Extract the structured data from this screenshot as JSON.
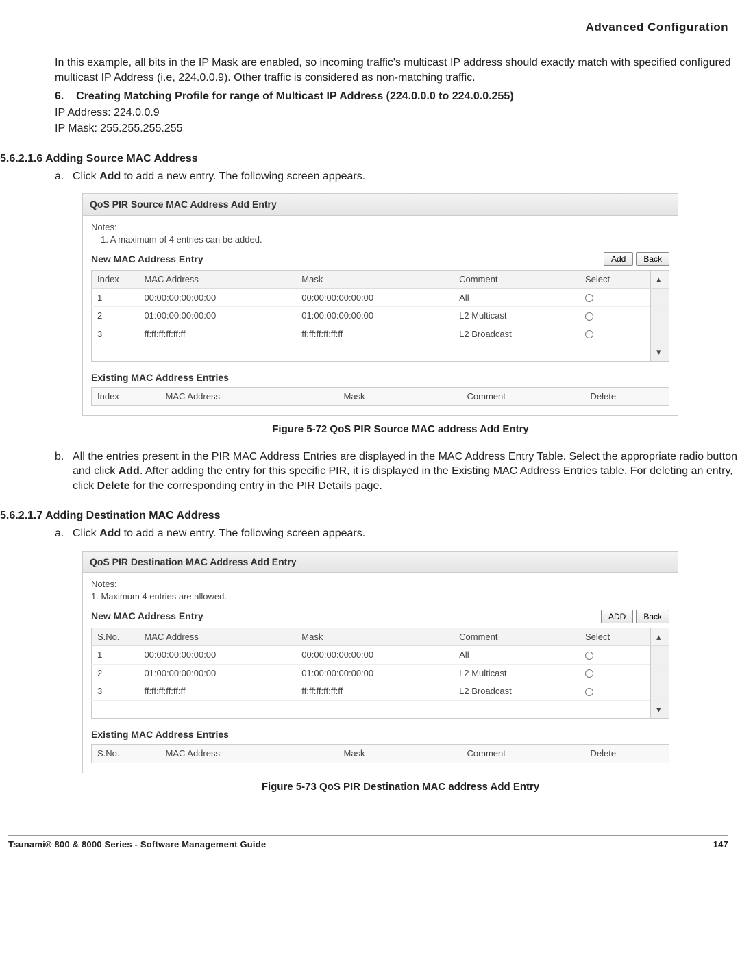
{
  "header": {
    "title": "Advanced Configuration"
  },
  "intro": {
    "p1": "In this example, all bits in the IP Mask are enabled, so incoming traffic's multicast IP address should exactly match with specified configured multicast IP Address (i.e, 224.0.0.9). Other traffic is considered as non-matching traffic."
  },
  "step6": {
    "num": "6.",
    "title": "Creating Matching Profile for range of Multicast IP Address (224.0.0.0 to 224.0.0.255)",
    "line1": "IP Address: 224.0.0.9",
    "line2": "IP Mask: 255.255.255.255"
  },
  "sec1": {
    "heading": "5.6.2.1.6 Adding Source MAC Address",
    "sub_a_letter": "a.",
    "sub_a_text_pre": "Click ",
    "sub_a_text_bold": "Add",
    "sub_a_text_post": " to add a new entry. The following screen appears.",
    "fig": {
      "titlebar": "QoS PIR Source MAC Address Add Entry",
      "notes_label": "Notes:",
      "note1": "1. A maximum of 4 entries can be added.",
      "new_title": "New MAC Address Entry",
      "btn_add": "Add",
      "btn_back": "Back",
      "headers": {
        "h1": "Index",
        "h2": "MAC Address",
        "h3": "Mask",
        "h4": "Comment",
        "h5": "Select"
      },
      "rows": [
        {
          "idx": "1",
          "mac": "00:00:00:00:00:00",
          "mask": "00:00:00:00:00:00",
          "comment": "All"
        },
        {
          "idx": "2",
          "mac": "01:00:00:00:00:00",
          "mask": "01:00:00:00:00:00",
          "comment": "L2 Multicast"
        },
        {
          "idx": "3",
          "mac": "ff:ff:ff:ff:ff:ff",
          "mask": "ff:ff:ff:ff:ff:ff",
          "comment": "L2 Broadcast"
        }
      ],
      "existing_title": "Existing MAC Address Entries",
      "eheaders": {
        "h1": "Index",
        "h2": "MAC Address",
        "h3": "Mask",
        "h4": "Comment",
        "h5": "Delete"
      }
    },
    "caption": "Figure 5-72 QoS PIR Source MAC address Add Entry",
    "sub_b_letter": "b.",
    "sub_b_text": "All the entries present in the PIR MAC Address Entries are displayed in the MAC Address Entry Table. Select the appropriate radio button and click ",
    "sub_b_bold1": "Add",
    "sub_b_mid": ". After adding the entry for this specific PIR, it is displayed in the Existing MAC Address Entries table. For deleting an entry, click ",
    "sub_b_bold2": "Delete",
    "sub_b_end": " for the corresponding entry in the PIR Details page."
  },
  "sec2": {
    "heading": "5.6.2.1.7 Adding Destination MAC Address",
    "sub_a_letter": "a.",
    "sub_a_text_pre": "Click ",
    "sub_a_text_bold": "Add",
    "sub_a_text_post": " to add a new entry. The following screen appears.",
    "fig": {
      "titlebar": "QoS PIR Destination MAC Address Add Entry",
      "notes_label": "Notes:",
      "note1": "1. Maximum 4 entries are allowed.",
      "new_title": "New MAC Address Entry",
      "btn_add": "ADD",
      "btn_back": "Back",
      "headers": {
        "h1": "S.No.",
        "h2": "MAC Address",
        "h3": "Mask",
        "h4": "Comment",
        "h5": "Select"
      },
      "rows": [
        {
          "idx": "1",
          "mac": "00:00:00:00:00:00",
          "mask": "00:00:00:00:00:00",
          "comment": "All"
        },
        {
          "idx": "2",
          "mac": "01:00:00:00:00:00",
          "mask": "01:00:00:00:00:00",
          "comment": "L2 Multicast"
        },
        {
          "idx": "3",
          "mac": "ff:ff:ff:ff:ff:ff",
          "mask": "ff:ff:ff:ff:ff:ff",
          "comment": "L2 Broadcast"
        }
      ],
      "existing_title": "Existing MAC Address Entries",
      "eheaders": {
        "h1": "S.No.",
        "h2": "MAC Address",
        "h3": "Mask",
        "h4": "Comment",
        "h5": "Delete"
      }
    },
    "caption": "Figure 5-73 QoS PIR Destination MAC address Add Entry"
  },
  "footer": {
    "left": "Tsunami® 800 & 8000 Series - Software Management Guide",
    "right": "147"
  }
}
